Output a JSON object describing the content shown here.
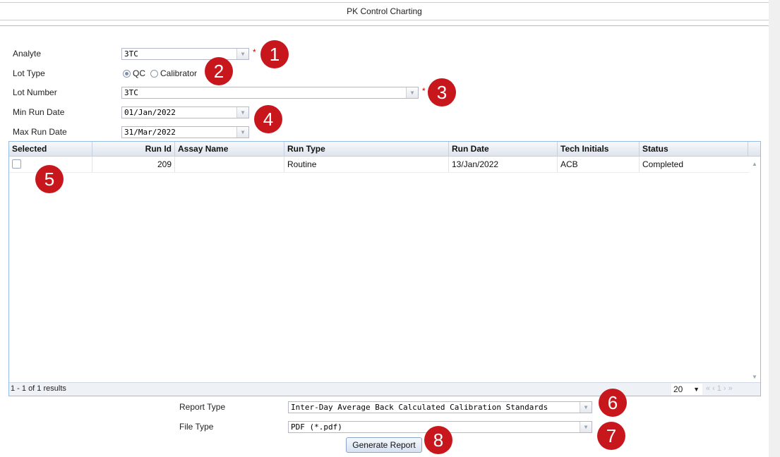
{
  "page": {
    "title": "PK Control Charting"
  },
  "form": {
    "analyte": {
      "label": "Analyte",
      "value": "3TC"
    },
    "lot_type": {
      "label": "Lot Type",
      "options": [
        "QC",
        "Calibrator"
      ],
      "selected": "QC"
    },
    "lot_number": {
      "label": "Lot Number",
      "value": "3TC"
    },
    "min_run_date": {
      "label": "Min Run Date",
      "value": "01/Jan/2022"
    },
    "max_run_date": {
      "label": "Max Run Date",
      "value": "31/Mar/2022"
    },
    "required_mark": "*"
  },
  "grid": {
    "columns": [
      "Selected",
      "Run Id",
      "Assay Name",
      "Run Type",
      "Run Date",
      "Tech Initials",
      "Status"
    ],
    "rows": [
      {
        "selected": false,
        "run_id": "209",
        "assay_name": "",
        "run_type": "Routine",
        "run_date": "13/Jan/2022",
        "tech_initials": "ACB",
        "status": "Completed"
      }
    ],
    "footer": {
      "results": "1 - 1 of 1 results",
      "page_size": "20",
      "page": "1"
    }
  },
  "report": {
    "report_type": {
      "label": "Report Type",
      "value": "Inter-Day Average Back Calculated Calibration Standards"
    },
    "file_type": {
      "label": "File Type",
      "value": "PDF (*.pdf)"
    },
    "generate_label": "Generate Report"
  },
  "badges": [
    "1",
    "2",
    "3",
    "4",
    "5",
    "6",
    "7",
    "8"
  ],
  "colors": {
    "badge": "#c8161d",
    "required": "#cc0000",
    "grid_border": "#99bbe8"
  }
}
